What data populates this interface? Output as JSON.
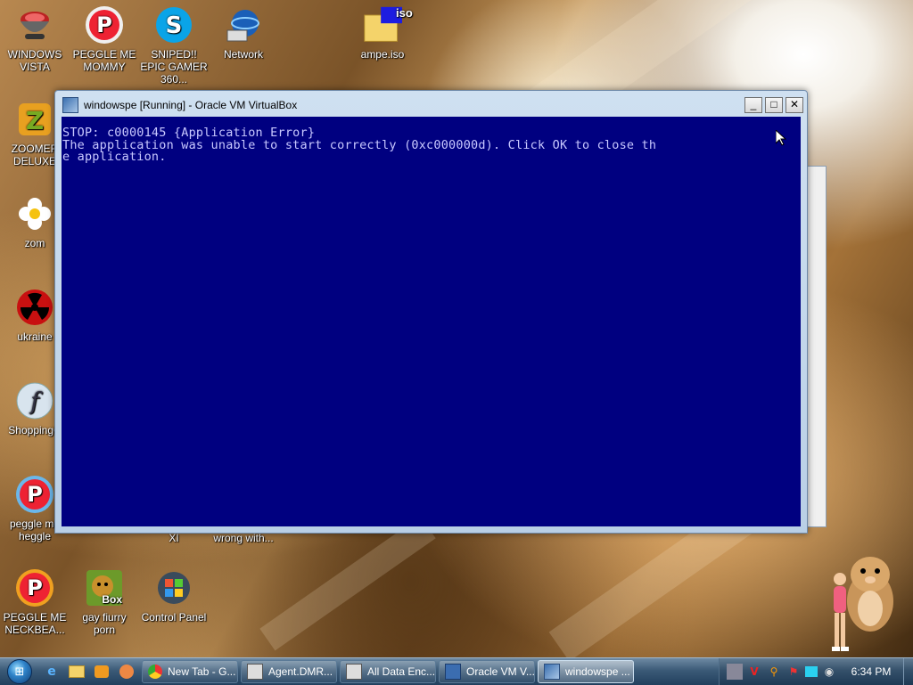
{
  "desktop": {
    "icons": [
      {
        "label": "WINDOWS VISTA"
      },
      {
        "label": "PEGGLE ME MOMMY"
      },
      {
        "label": "SNIPED!! EPIC GAMER 360..."
      },
      {
        "label": "Network"
      },
      {
        "label": "ampe.iso"
      },
      {
        "label": "ZOOMER DELUXE"
      },
      {
        "label": "zom"
      },
      {
        "label": "ukraine"
      },
      {
        "label": "ShoppingC"
      },
      {
        "label": "peggle me heggle"
      },
      {
        "label": "XI"
      },
      {
        "label": "wrong with..."
      },
      {
        "label": "PEGGLE ME NECKBEA..."
      },
      {
        "label": "gay fiurry porn"
      },
      {
        "label": "Control Panel"
      }
    ],
    "iso_badge": "iso",
    "box_badge": "Box"
  },
  "window": {
    "title": "windowspe [Running] - Oracle VM VirtualBox",
    "minimize": "_",
    "maximize": "□",
    "close": "✕",
    "bsod_lines": [
      "STOP: c0000145 {Application Error}",
      "The application was unable to start correctly (0xc000000d). Click OK to close th",
      "e application."
    ]
  },
  "taskbar": {
    "tasks": [
      {
        "label": "New Tab - G..."
      },
      {
        "label": "Agent.DMR..."
      },
      {
        "label": "All Data Enc..."
      },
      {
        "label": "Oracle VM V..."
      },
      {
        "label": "windowspe ..."
      }
    ],
    "clock": "6:34 PM"
  },
  "colors": {
    "bsod_bg": "#000080",
    "bsod_text": "#c8c8ff"
  }
}
